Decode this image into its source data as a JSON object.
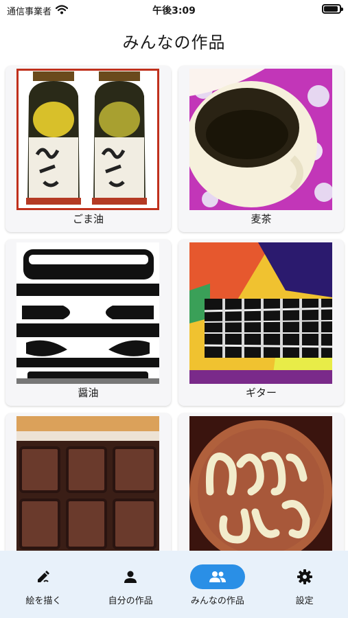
{
  "status_bar": {
    "carrier": "通信事業者",
    "time": "午後3:09",
    "battery_level": 0.9
  },
  "header": {
    "title": "みんなの作品"
  },
  "gallery": [
    {
      "label": "ごま油"
    },
    {
      "label": "麦茶"
    },
    {
      "label": "醤油"
    },
    {
      "label": "ギター"
    },
    {
      "label": ""
    },
    {
      "label": ""
    }
  ],
  "tab_bar": {
    "accent": "#2a8fe6",
    "tabs": [
      {
        "label": "絵を描く",
        "icon": "draw-icon"
      },
      {
        "label": "自分の作品",
        "icon": "person-icon"
      },
      {
        "label": "みんなの作品",
        "icon": "group-icon",
        "active": true
      },
      {
        "label": "設定",
        "icon": "gear-icon"
      }
    ]
  }
}
